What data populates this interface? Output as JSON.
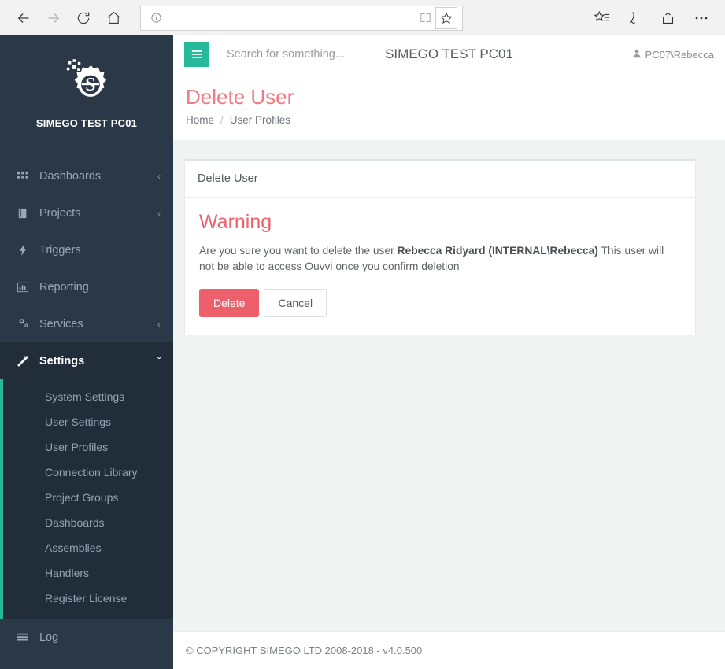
{
  "browser": {
    "back_icon": "arrow-left-icon",
    "forward_icon": "arrow-right-icon",
    "refresh_icon": "refresh-icon",
    "home_icon": "home-icon",
    "address_value": "",
    "address_placeholder": "",
    "info_icon": "info-icon",
    "reading_view_icon": "book-icon",
    "favorite_icon": "star-icon",
    "hub_icon": "hub-star-list-icon",
    "web_note_icon": "pen-icon",
    "share_icon": "share-icon",
    "more_icon": "ellipsis-icon"
  },
  "sidebar": {
    "logo_icon": "simego-gear-logo",
    "brand": "SIMEGO TEST PC01",
    "accent_color": "#26b99a",
    "background_color": "#2b3847",
    "items": [
      {
        "label": "Dashboards",
        "icon": "grid-icon",
        "caret": "‹",
        "active": false
      },
      {
        "label": "Projects",
        "icon": "book-icon",
        "caret": "‹",
        "active": false
      },
      {
        "label": "Triggers",
        "icon": "bolt-icon",
        "caret": "",
        "active": false
      },
      {
        "label": "Reporting",
        "icon": "bar-chart-icon",
        "caret": "",
        "active": false
      },
      {
        "label": "Services",
        "icon": "gears-icon",
        "caret": "‹",
        "active": false
      }
    ],
    "settings": {
      "label": "Settings",
      "icon": "magic-wand-icon",
      "caret": "ˇ",
      "active": true,
      "sub_items": [
        "System Settings",
        "User Settings",
        "User Profiles",
        "Connection Library",
        "Project Groups",
        "Dashboards",
        "Assemblies",
        "Handlers",
        "Register License"
      ]
    },
    "log": {
      "label": "Log",
      "icon": "list-icon"
    }
  },
  "topbar": {
    "menu_icon": "hamburger-icon",
    "menu_color": "#26b99a",
    "search_placeholder": "Search for something...",
    "search_value": "",
    "title": "SIMEGO TEST PC01",
    "user_icon": "user-icon",
    "user_name": "PC07\\Rebecca"
  },
  "page": {
    "title": "Delete User",
    "title_color": "#ee7a81",
    "breadcrumb": [
      {
        "label": "Home"
      },
      {
        "label": "User Profiles"
      }
    ],
    "breadcrumb_separator": "/"
  },
  "card": {
    "header": "Delete User",
    "warning_heading": "Warning",
    "warning_color": "#ee5f6c",
    "message_prefix": "Are you sure you want to delete the user ",
    "message_user": "Rebecca Ridyard (INTERNAL\\Rebecca)",
    "message_suffix": " This user will not be able to access Ouvvi once you confirm deletion",
    "delete_label": "Delete",
    "delete_color": "#ee5f6c",
    "cancel_label": "Cancel"
  },
  "footer": {
    "copyright": "© COPYRIGHT SIMEGO LTD 2008-2018 - v4.0.500"
  }
}
